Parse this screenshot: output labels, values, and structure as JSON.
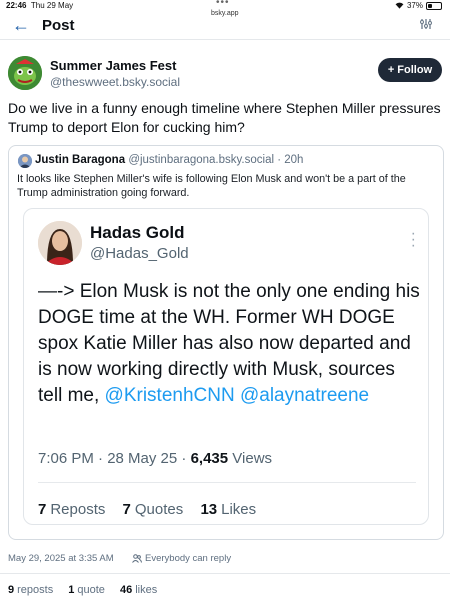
{
  "status_bar": {
    "time": "22:46",
    "date": "Thu 29 May",
    "url": "bsky.app",
    "battery": "37%"
  },
  "header": {
    "title": "Post"
  },
  "post": {
    "author_name": "Summer James Fest",
    "author_handle": "@theswweet.bsky.social",
    "follow_label": "Follow",
    "text": "Do we live in a funny enough timeline where Stephen Miller pressures Trump to deport Elon for cucking him?",
    "timestamp": "May 29, 2025 at 3:35 AM",
    "reply_permission": "Everybody can reply",
    "reposts_count": "9",
    "reposts_label": "reposts",
    "quotes_count": "1",
    "quotes_label": "quote",
    "likes_count": "46",
    "likes_label": "likes"
  },
  "quote": {
    "author_name": "Justin Baragona",
    "author_handle": "@justinbaragona.bsky.social",
    "age": "· 20h",
    "text": "It looks like Stephen Miller's wife is following Elon Musk and won't be a part of the Trump administration going forward.",
    "embed": {
      "name": "Hadas Gold",
      "handle": "@Hadas_Gold",
      "text_main": "—-> Elon Musk is not the only one ending his DOGE time at the WH. Former WH DOGE spox Katie Miller has also now departed and is now working directly with Musk, sources tell me,",
      "mention1": "@KristenhCNN",
      "mention2": "@alaynatreene",
      "time": "7:06 PM · 28 May 25 ·",
      "views_count": "6,435",
      "views_label": "Views",
      "reposts_count": "7",
      "reposts_label": "Reposts",
      "quotes_count": "7",
      "quotes_label": "Quotes",
      "likes_count": "13",
      "likes_label": "Likes"
    }
  },
  "colors": {
    "link": "#1d9bf0",
    "follow_bg": "#1f2937",
    "back_arrow": "#1f5fa8"
  },
  "icons": [
    "back-arrow-icon",
    "filter-icon",
    "plus-icon",
    "more-vertical-icon",
    "people-icon",
    "wifi-icon",
    "battery-icon"
  ]
}
